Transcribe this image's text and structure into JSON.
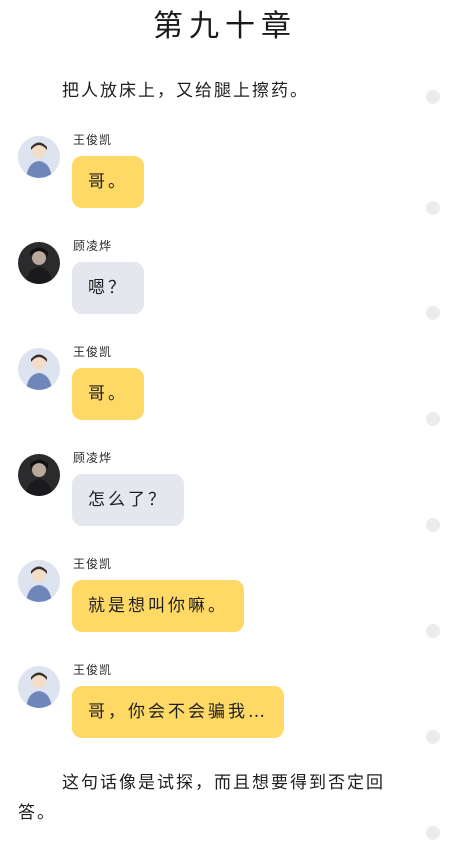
{
  "chapter": {
    "title": "第九十章"
  },
  "narration": {
    "first": "把人放床上，又给腿上擦药。",
    "last": "这句话像是试探，而且想要得到否定回答。"
  },
  "messages": [
    {
      "sender": "王俊凯",
      "text": "哥。",
      "style": "yellow",
      "avatar": "light-avatar-icon"
    },
    {
      "sender": "顾凌烨",
      "text": "嗯？",
      "style": "gray",
      "avatar": "dark-avatar-icon"
    },
    {
      "sender": "王俊凯",
      "text": "哥。",
      "style": "yellow",
      "avatar": "light-avatar-icon"
    },
    {
      "sender": "顾凌烨",
      "text": "怎么了？",
      "style": "gray",
      "avatar": "dark-avatar-icon"
    },
    {
      "sender": "王俊凯",
      "text": "就是想叫你嘛。",
      "style": "yellow",
      "avatar": "light-avatar-icon"
    },
    {
      "sender": "王俊凯",
      "text": "哥，你会不会骗我…",
      "style": "yellow",
      "avatar": "light-avatar-icon"
    }
  ],
  "colors": {
    "bubble_yellow": "#ffd966",
    "bubble_gray": "#e4e8ee",
    "scroll_dot": "#ececec"
  }
}
